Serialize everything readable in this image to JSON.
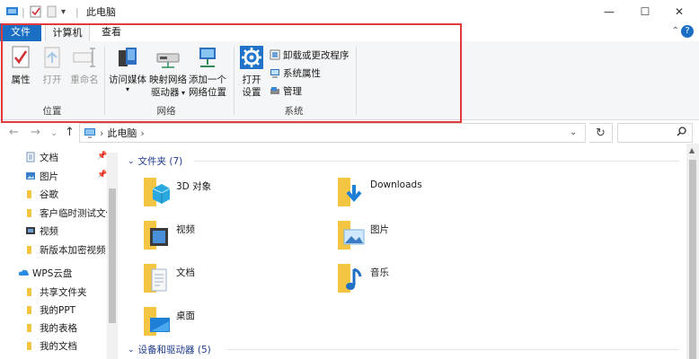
{
  "titlebar": {
    "title": "此电脑",
    "minimize": "—",
    "maximize": "☐",
    "close": "✕"
  },
  "tabs": {
    "file": "文件",
    "computer": "计算机",
    "view": "查看",
    "collapse": "⌃",
    "help": "?"
  },
  "ribbon": {
    "properties": "属性",
    "open": "打开",
    "rename": "重命名",
    "group_location": "位置",
    "access_media": "访问媒体",
    "map_drive_1": "映射网络",
    "map_drive_2": "驱动器",
    "add_network_1": "添加一个",
    "add_network_2": "网络位置",
    "group_network": "网络",
    "open_settings_1": "打开",
    "open_settings_2": "设置",
    "uninstall": "卸载或更改程序",
    "sys_props": "系统属性",
    "manage": "管理",
    "group_system": "系统"
  },
  "address": {
    "back": "←",
    "forward": "→",
    "up": "↑",
    "path": "此电脑",
    "sep": "›",
    "dropdown": "⌄",
    "refresh": "↻"
  },
  "nav": {
    "items": [
      {
        "label": "文档",
        "pinned": true
      },
      {
        "label": "图片",
        "pinned": true
      },
      {
        "label": "谷歌"
      },
      {
        "label": "客户临时测试文件"
      },
      {
        "label": "视频"
      },
      {
        "label": "新版本加密视频"
      },
      {
        "label": "WPS云盘"
      },
      {
        "label": "共享文件夹"
      },
      {
        "label": "我的PPT"
      },
      {
        "label": "我的表格"
      },
      {
        "label": "我的文档"
      }
    ]
  },
  "content": {
    "folders_header": "文件夹 (7)",
    "devices_header": "设备和驱动器 (5)",
    "folders": [
      {
        "name": "3D 对象"
      },
      {
        "name": "Downloads"
      },
      {
        "name": "视频"
      },
      {
        "name": "图片"
      },
      {
        "name": "文档"
      },
      {
        "name": "音乐"
      },
      {
        "name": "桌面"
      }
    ]
  },
  "colors": {
    "accent": "#1a6fc4",
    "highlight_frame": "#e23a3a",
    "folder": "#f4c542"
  }
}
